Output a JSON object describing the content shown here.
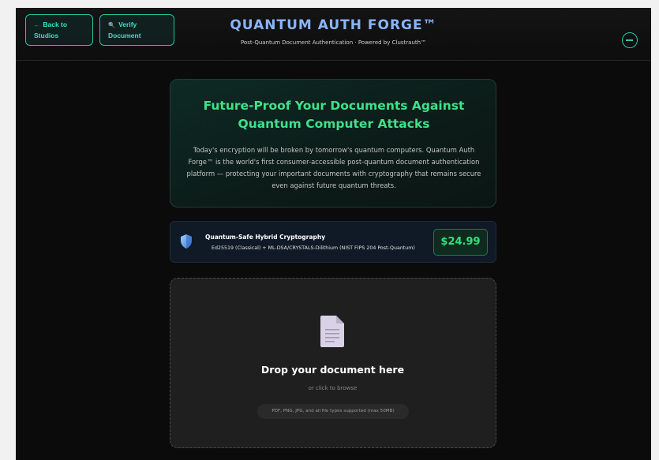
{
  "header": {
    "back_label": "Back to Studios",
    "back_icon": "←",
    "verify_label": "Verify Document",
    "verify_icon": "🔍",
    "title": "QUANTUM AUTH FORGE™",
    "subtitle": "Post-Quantum Document Authentication · Powered by Clustrauth™"
  },
  "hero": {
    "title": "Future-Proof Your Documents Against Quantum Computer Attacks",
    "description": "Today's encryption will be broken by tomorrow's quantum computers. Quantum Auth Forge™ is the world's first consumer-accessible post-quantum document authentication platform — protecting your important documents with cryptography that remains secure even against future quantum threats."
  },
  "crypto": {
    "title": "Quantum-Safe Hybrid Cryptography",
    "algorithms": "Ed25519 (Classical) + ML-DSA/CRYSTALS-Dilithium (NIST FIPS 204 Post-Quantum)",
    "price": "$24.99"
  },
  "upload": {
    "title": "Drop your document here",
    "subtitle": "or click to browse",
    "types": "PDF, PNG, JPG, and all file types supported (max 50MB)"
  },
  "colors": {
    "accent": "#25c9a9",
    "title_blue": "#8ab4ff",
    "price_green": "#33e07a",
    "background": "#0b0b0b"
  },
  "icons": [
    "back-arrow-icon",
    "search-icon",
    "menu-icon",
    "shield-icon",
    "document-icon"
  ]
}
